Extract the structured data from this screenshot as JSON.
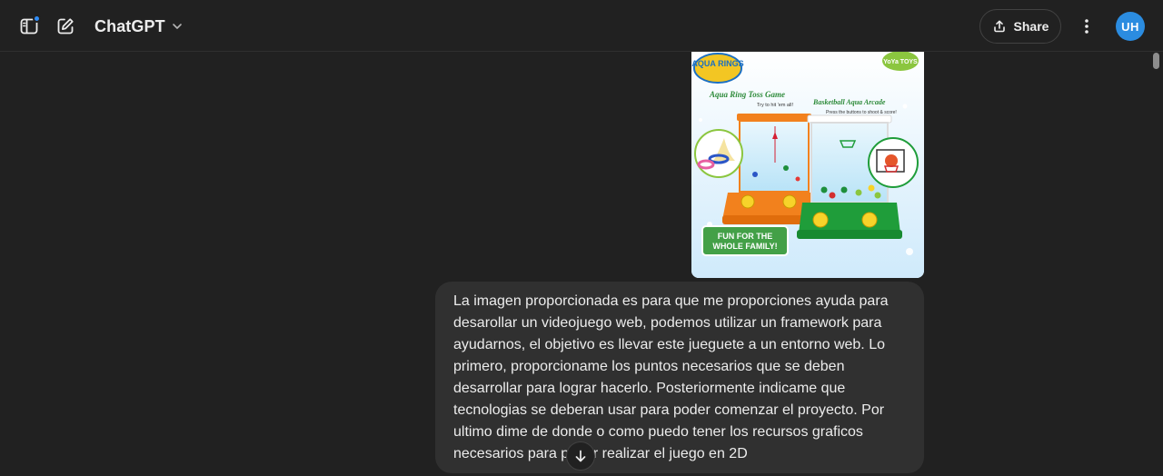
{
  "header": {
    "model_name": "ChatGPT",
    "share_label": "Share",
    "avatar_initials": "UH"
  },
  "icons": {
    "sidebar": "sidebar-toggle-icon",
    "new_chat": "new-chat-icon",
    "model_chevron": "chevron-down-icon",
    "share": "share-upload-icon",
    "more": "more-vertical-icon",
    "scroll_down": "arrow-down-icon"
  },
  "image_card": {
    "brand_left": "AQUA RINGS",
    "brand_right": "YoYa TOYS",
    "caption_left": "Aqua Ring Toss Game",
    "subcaption_left": "Try to hit 'em all!",
    "caption_right": "Basketball Aqua Arcade",
    "subcaption_right": "Press the buttons to shoot & score!",
    "badge_line1": "FUN FOR THE",
    "badge_line2": "WHOLE FAMILY!"
  },
  "message": {
    "text": "La imagen proporcionada es para que me proporciones ayuda para\ndesarollar un videojuego web, podemos utilizar un framework para\nayudarnos, el objetivo es llevar este jueguete a un entorno web. Lo\nprimero, proporcioname los puntos necesarios que se deben\ndesarrollar para lograr hacerlo. Posteriormente indicame que\ntecnologias se deberan usar para poder comenzar el proyecto. Por\nultimo dime de donde o como puedo tener los recursos graficos\nnecesarios para poder realizar el juego en 2D"
  },
  "colors": {
    "background": "#212121",
    "bubble": "#303030",
    "accent": "#2b8ce0",
    "notification": "#2f8cf5"
  }
}
